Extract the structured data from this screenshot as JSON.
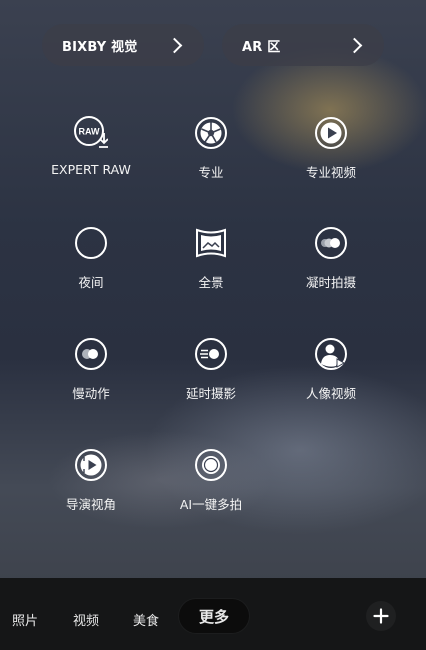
{
  "top_buttons": {
    "bixby": "BIXBY 视觉",
    "ar": "AR 区"
  },
  "modes": [
    {
      "label": "EXPERT RAW",
      "icon": "raw-download-icon",
      "badge": "RAW"
    },
    {
      "label": "专业",
      "icon": "aperture-icon"
    },
    {
      "label": "专业视频",
      "icon": "pro-video-play-icon"
    },
    {
      "label": "夜间",
      "icon": "moon-icon"
    },
    {
      "label": "全景",
      "icon": "panorama-icon"
    },
    {
      "label": "凝时拍摄",
      "icon": "hyperlapse-icon"
    },
    {
      "label": "慢动作",
      "icon": "slow-motion-icon"
    },
    {
      "label": "延时摄影",
      "icon": "timelapse-icon"
    },
    {
      "label": "人像视频",
      "icon": "portrait-video-icon"
    },
    {
      "label": "导演视角",
      "icon": "directors-view-icon"
    },
    {
      "label": "AI一键多拍",
      "icon": "single-take-icon"
    }
  ],
  "bottom_tabs": [
    "照片",
    "视频",
    "美食",
    "更多"
  ],
  "active_tab": "更多",
  "add_icon": "plus-icon"
}
